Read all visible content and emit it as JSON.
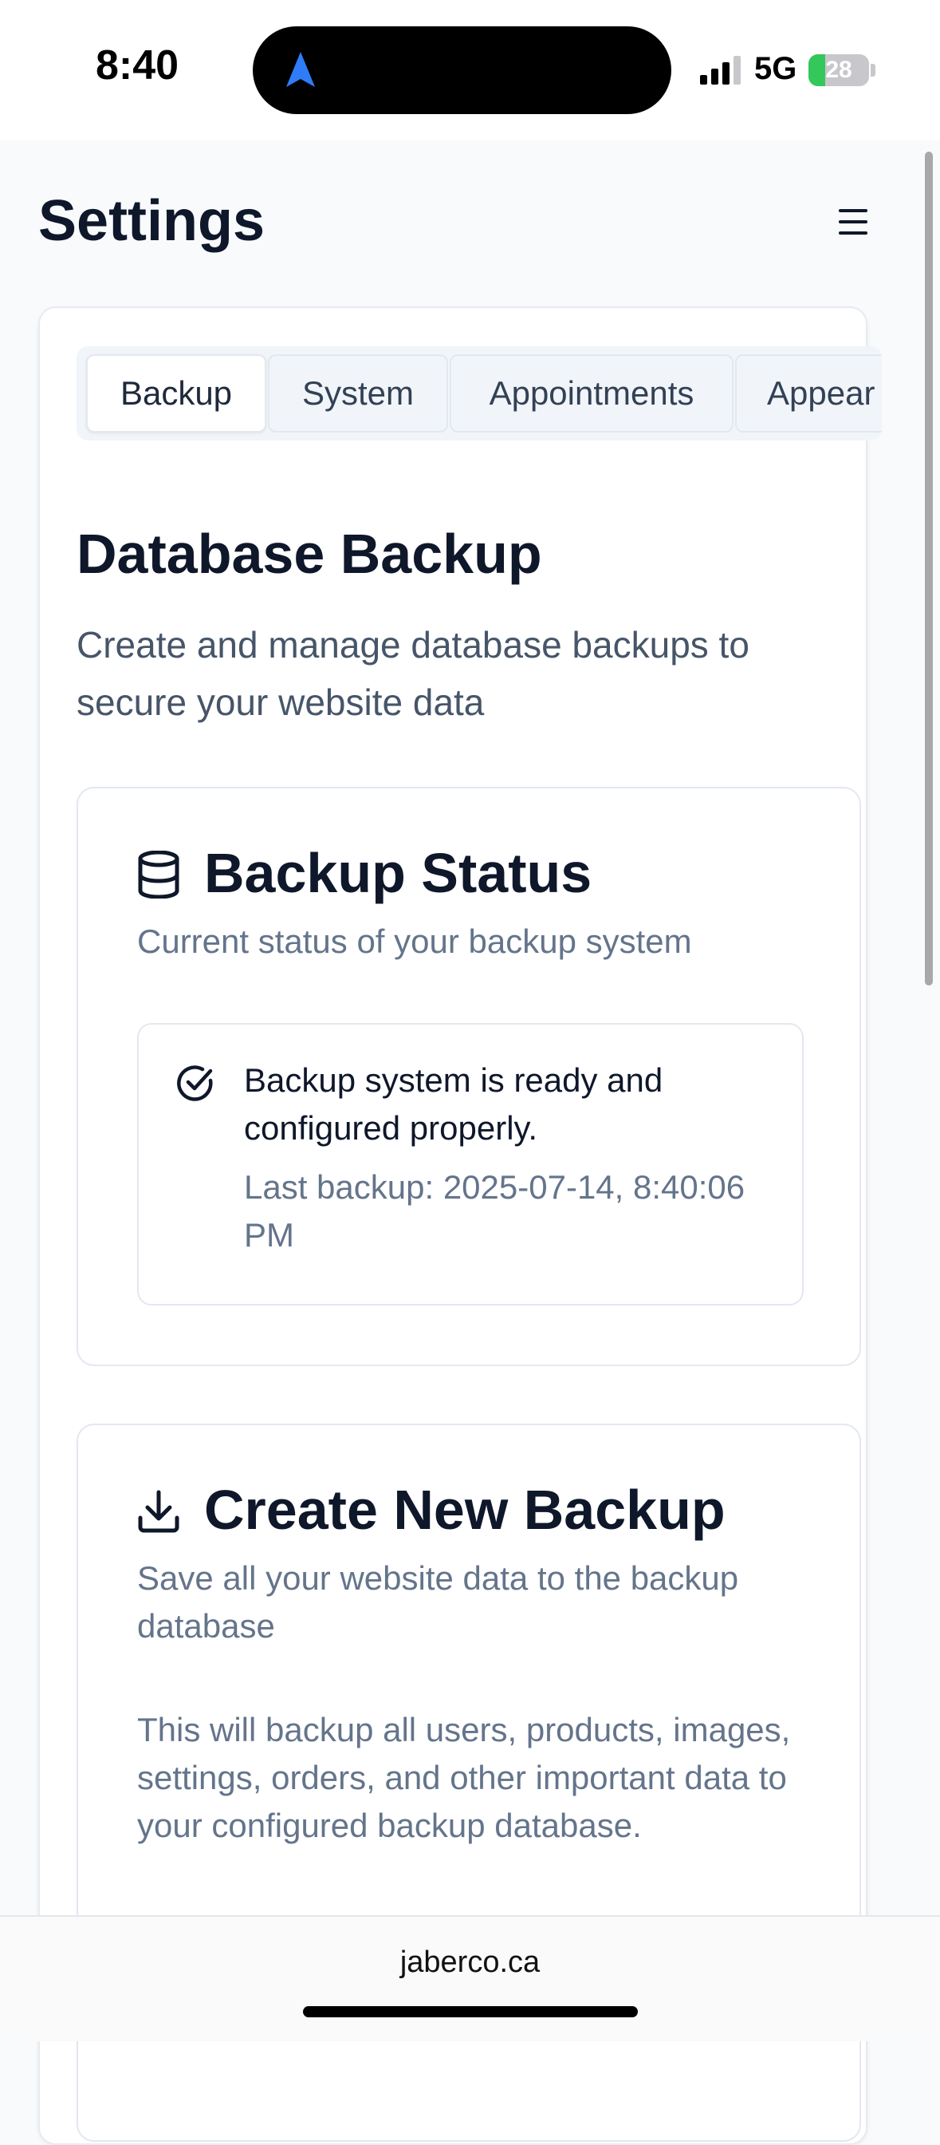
{
  "status_bar": {
    "time": "8:40",
    "network": "5G",
    "battery_percent": 28,
    "battery_label": "28",
    "signal_bars": 3
  },
  "header": {
    "title": "Settings",
    "menu_icon": "hamburger-menu-icon"
  },
  "tabs": [
    {
      "label": "Backup",
      "active": true
    },
    {
      "label": "System",
      "active": false
    },
    {
      "label": "Appointments",
      "active": false
    },
    {
      "label": "Appear",
      "active": false
    }
  ],
  "section": {
    "title": "Database Backup",
    "description": "Create and manage database backups to secure your website data"
  },
  "backup_status": {
    "icon": "database-icon",
    "title": "Backup Status",
    "subtitle": "Current status of your backup system",
    "alert": {
      "icon": "check-circle-icon",
      "message": "Backup system is ready and configured properly.",
      "last_backup": "Last backup: 2025-07-14, 8:40:06 PM"
    }
  },
  "create_backup": {
    "icon": "download-icon",
    "title": "Create New Backup",
    "subtitle": "Save all your website data to the backup database",
    "info": "This will backup all users, products, images, settings, orders, and other important data to your configured backup database."
  },
  "browser": {
    "url": "jaberco.ca"
  },
  "colors": {
    "background": "#f8fafc",
    "card": "#ffffff",
    "border": "#e2e8f0",
    "text_primary": "#0f172a",
    "text_muted": "#64748b",
    "battery_green": "#34c759"
  }
}
